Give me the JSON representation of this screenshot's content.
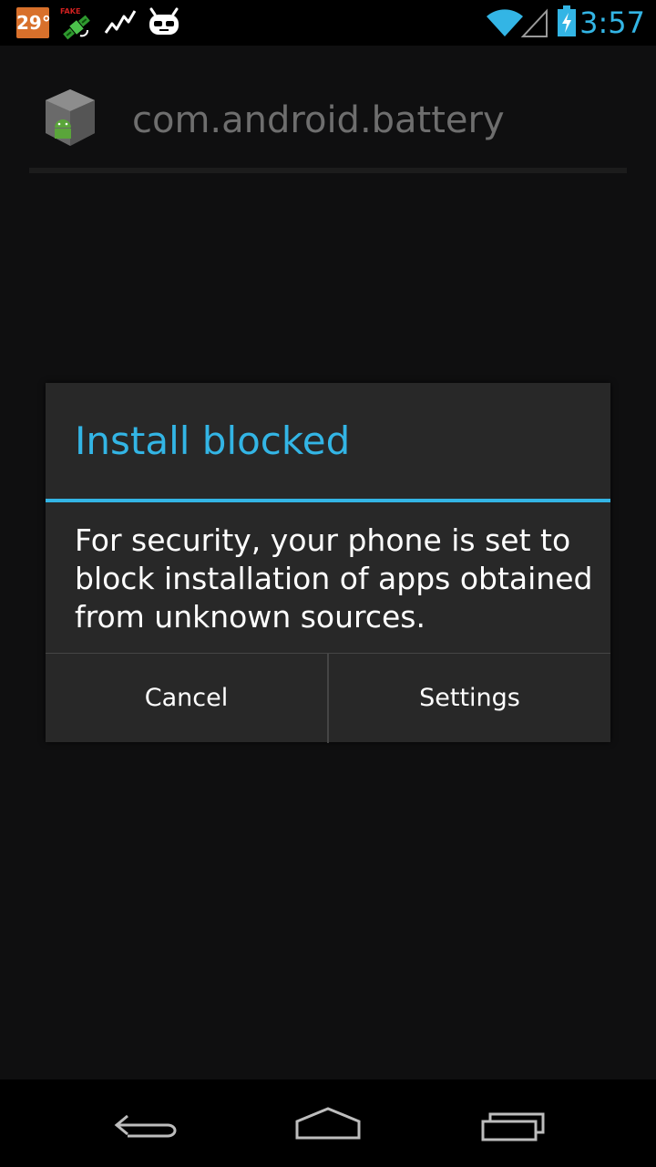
{
  "status_bar": {
    "temperature": "29°",
    "fake_gps_label": "FAKE",
    "icons": [
      "weather-temp-badge",
      "fake-gps-satellite-icon",
      "activity-chart-icon",
      "cyanogenmod-mascot-icon",
      "wifi-icon",
      "cellular-signal-icon",
      "battery-charging-icon"
    ],
    "time": "3:57"
  },
  "app": {
    "title": "com.android.battery",
    "icon": "package-installer-icon"
  },
  "dialog": {
    "title": "Install blocked",
    "message": "For security, your phone is set to block installation of apps obtained from unknown sources.",
    "buttons": {
      "cancel": "Cancel",
      "settings": "Settings"
    }
  },
  "navigation": {
    "back": "back-icon",
    "home": "home-icon",
    "recent": "recent-apps-icon"
  },
  "colors": {
    "accent": "#33b5e5",
    "dialog_bg": "#282828",
    "screen_bg": "#0f0f10",
    "temp_badge": "#d8702b"
  }
}
